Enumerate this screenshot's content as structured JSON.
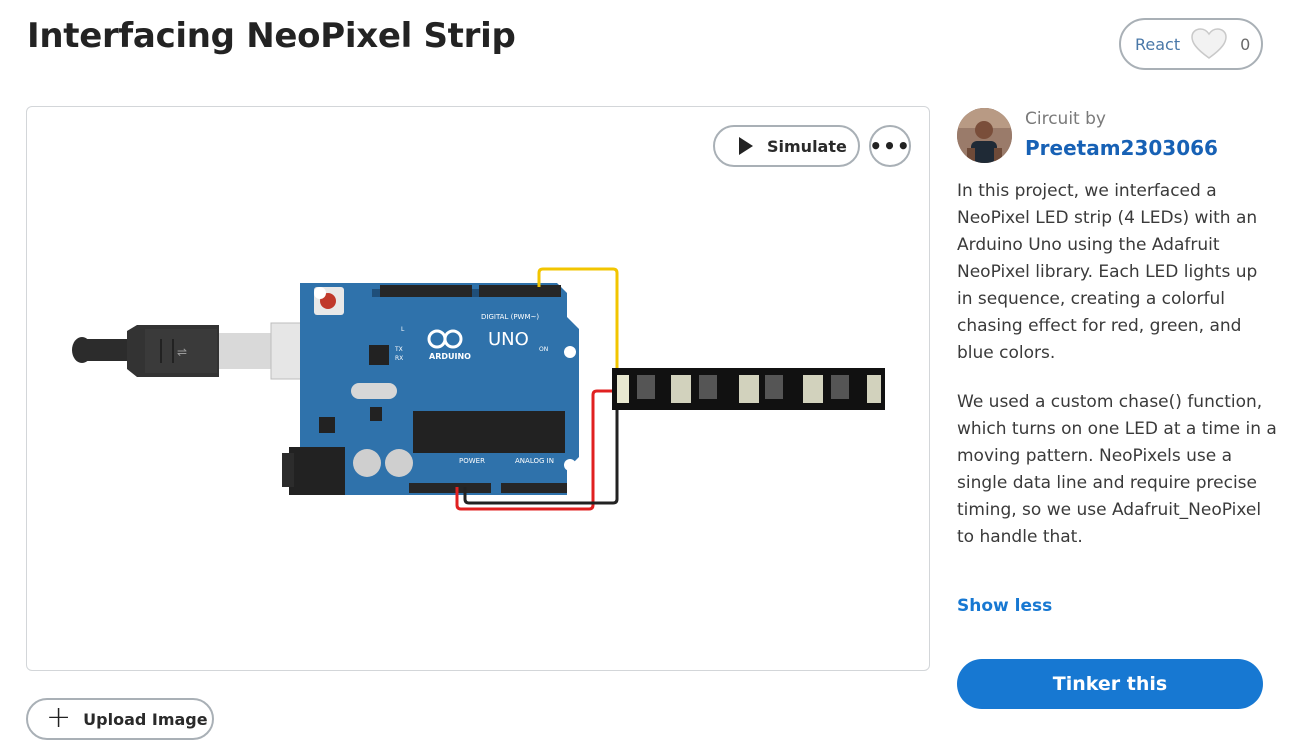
{
  "title": "Interfacing NeoPixel Strip",
  "react": {
    "label": "React",
    "count": "0"
  },
  "viewer": {
    "simulate_label": "Simulate",
    "more_label": "•••",
    "board": {
      "brand": "ARDUINO",
      "model": "UNO",
      "digital_label": "DIGITAL (PWM~)",
      "power_label": "POWER",
      "analog_label": "ANALOG IN",
      "on_label": "ON",
      "tx_label": "TX",
      "rx_label": "RX",
      "l_label": "L"
    }
  },
  "upload_label": "Upload Image",
  "sidebar": {
    "circuit_by": "Circuit by",
    "author": "Preetam2303066",
    "description_1": "In this project, we interfaced a NeoPixel LED strip (4 LEDs) with an Arduino Uno using the Adafruit NeoPixel library. Each LED lights up in sequence, creating a colorful chasing effect for red, green, and blue colors.",
    "description_2": "We used a custom chase() function, which turns on one LED at a time in a moving pattern. NeoPixels use a single data line and require precise timing, so we use Adafruit_NeoPixel to handle that.",
    "show_less": "Show less",
    "tinker_label": "Tinker this"
  },
  "colors": {
    "accent": "#1778d2",
    "author_link": "#1761b5",
    "board_blue": "#2f72ab",
    "wire_yellow": "#f2c500",
    "wire_red": "#e02020",
    "wire_black": "#222222"
  },
  "icons": [
    "heart-icon",
    "play-icon",
    "more-icon",
    "plus-icon",
    "avatar"
  ]
}
